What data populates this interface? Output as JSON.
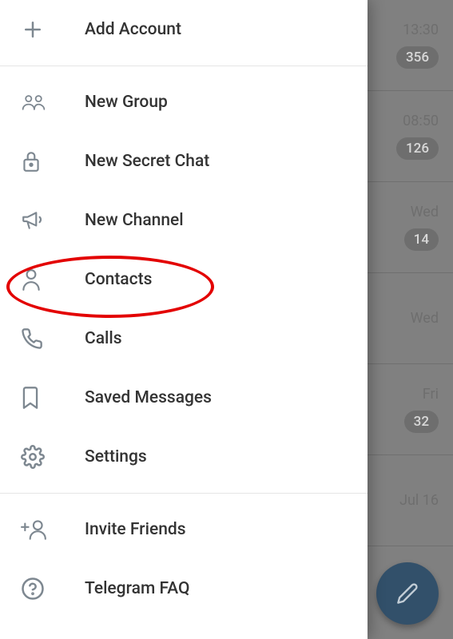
{
  "menu": {
    "addAccount": "Add Account",
    "newGroup": "New Group",
    "newSecretChat": "New Secret Chat",
    "newChannel": "New Channel",
    "contacts": "Contacts",
    "calls": "Calls",
    "savedMessages": "Saved Messages",
    "settings": "Settings",
    "inviteFriends": "Invite Friends",
    "telegramFaq": "Telegram FAQ"
  },
  "chats": [
    {
      "time": "13:30",
      "badge": "356"
    },
    {
      "time": "08:50",
      "badge": "126"
    },
    {
      "time": "Wed",
      "badge": "14"
    },
    {
      "time": "Wed",
      "badge": ""
    },
    {
      "time": "Fri",
      "badge": "32"
    },
    {
      "time": "Jul 16",
      "badge": ""
    }
  ]
}
